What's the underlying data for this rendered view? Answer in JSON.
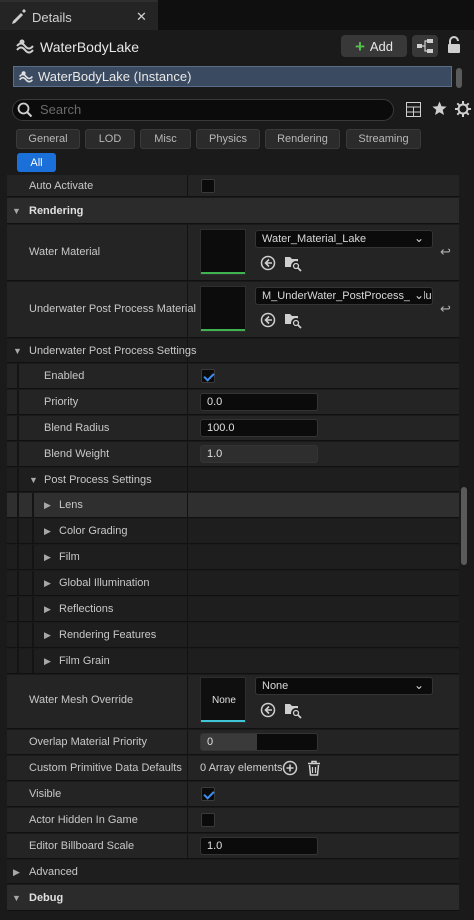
{
  "tab": {
    "title": "Details",
    "close": "✕"
  },
  "header": {
    "actor_name": "WaterBodyLake",
    "add_label": "Add",
    "instance_label": "WaterBodyLake (Instance)"
  },
  "search": {
    "placeholder": "Search"
  },
  "categories": [
    "General",
    "LOD",
    "Misc",
    "Physics",
    "Rendering",
    "Streaming",
    "All"
  ],
  "properties": {
    "auto_activate": {
      "label": "Auto Activate",
      "checked": false
    },
    "rendering_header": "Rendering",
    "water_material": {
      "label": "Water Material",
      "value": "Water_Material_Lake"
    },
    "underwater_material": {
      "label": "Underwater Post Process Material",
      "value": "M_UnderWater_PostProcess_Volume"
    },
    "underwater_settings_header": "Underwater Post Process Settings",
    "enabled": {
      "label": "Enabled",
      "checked": true
    },
    "priority": {
      "label": "Priority",
      "value": "0.0"
    },
    "blend_radius": {
      "label": "Blend Radius",
      "value": "100.0"
    },
    "blend_weight": {
      "label": "Blend Weight",
      "value": "1.0",
      "fill": 1.0
    },
    "post_process_header": "Post Process Settings",
    "pp_sections": [
      "Lens",
      "Color Grading",
      "Film",
      "Global Illumination",
      "Reflections",
      "Rendering Features",
      "Film Grain"
    ],
    "water_mesh_override": {
      "label": "Water Mesh Override",
      "thumb": "None",
      "value": "None"
    },
    "overlap_priority": {
      "label": "Overlap Material Priority",
      "value": "0"
    },
    "custom_primitive": {
      "label": "Custom Primitive Data Defaults",
      "value": "0 Array elements"
    },
    "visible": {
      "label": "Visible",
      "checked": true
    },
    "actor_hidden": {
      "label": "Actor Hidden In Game",
      "checked": false
    },
    "billboard_scale": {
      "label": "Editor Billboard Scale",
      "value": "1.0"
    },
    "advanced_header": "Advanced",
    "debug_header": "Debug"
  },
  "colors": {
    "accent_blue": "#1b6fd8",
    "add_green": "#54c14a",
    "material_bar": "#3fb34f",
    "mesh_bar": "#3ec6d6"
  },
  "icons": [
    "details-icon",
    "close-icon",
    "water-body-icon",
    "add-icon",
    "blueprint-icon",
    "lock-icon",
    "search-icon",
    "table-view-icon",
    "star-icon",
    "gear-icon",
    "reset-icon",
    "browse-icon",
    "find-in-browser-icon",
    "add-element-icon",
    "trash-icon",
    "chevron-down-icon",
    "chevron-right-icon"
  ]
}
